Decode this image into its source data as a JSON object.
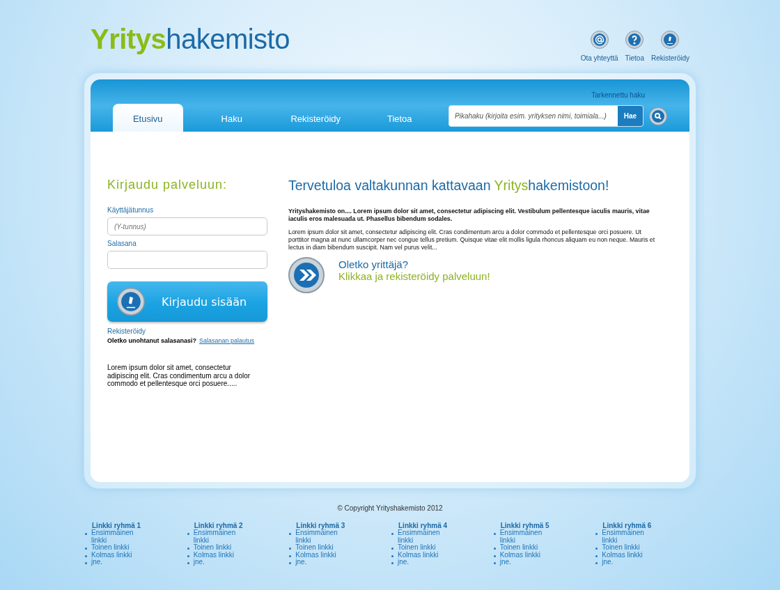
{
  "logo": {
    "first": "Yritys",
    "second": "hakemisto"
  },
  "top_links": [
    {
      "kind": "contact",
      "label": "Ota yhteyttä"
    },
    {
      "kind": "info",
      "label": "Tietoa"
    },
    {
      "kind": "register",
      "label": "Rekisteröidy"
    }
  ],
  "nav": {
    "tabs": [
      {
        "label": "Etusivu",
        "selected": true
      },
      {
        "label": "Haku",
        "selected": false
      },
      {
        "label": "Rekisteröidy",
        "selected": false
      },
      {
        "label": "Tietoa",
        "selected": false
      }
    ],
    "advanced_search": "Tarkennettu haku",
    "search": {
      "placeholder": "Pikahaku (kirjoita esim. yrityksen nimi, toimiala...)",
      "button": "Hae"
    }
  },
  "login": {
    "title": "Kirjaudu palveluun:",
    "fields": [
      {
        "label": "Käyttäjätunnus",
        "placeholder": "(Y-tunnus)"
      },
      {
        "label": "Salasana"
      }
    ],
    "button": "Kirjaudu sisään",
    "register": "Rekisteröidy",
    "forgot": "Oletko unohtanut salasanasi?",
    "reset": "Salasanan palautus",
    "text": "Lorem ipsum dolor sit amet, consectetur adipiscing elit. Cras condimentum arcu a dolor commodo et pellentesque orci posuere....."
  },
  "welcome": {
    "title": [
      {
        "text": "Tervetuloa valtakunnan kattavaan ",
        "highlight": false
      },
      {
        "text": "Yritys",
        "highlight": true
      },
      {
        "text": "hakemistoon!",
        "highlight": false
      }
    ],
    "intro": "Yrityshakemisto on.... Lorem ipsum dolor sit amet, consectetur adipiscing elit. Vestibulum pellentesque iaculis mauris, vitae iaculis eros malesuada ut. Phasellus bibendum sodales.",
    "body": "Lorem ipsum dolor sit amet, consectetur adipiscing elit. Cras condimentum arcu a dolor commodo et pellentesque orci posuere. Ut porttitor magna at nunc ullamcorper nec congue tellus pretium. Quisque vitae elit mollis ligula rhoncus aliquam eu non neque. Mauris et lectus in diam bibendum suscipit. Nam vel purus velit...",
    "cta_question": "Oletko yrittäjä?",
    "cta_action": "Klikkaa ja rekisteröidy palveluun!"
  },
  "copyright": "© Copyright Yrityshakemisto 2012",
  "footer_groups": [
    {
      "title": "Linkki ryhmä 1",
      "links": [
        "Ensimmäinen linkki",
        "Toinen linkki",
        "Kolmas linkki",
        "jne."
      ]
    },
    {
      "title": "Linkki ryhmä 2",
      "links": [
        "Ensimmäinen linkki",
        "Toinen linkki",
        "Kolmas linkki",
        "jne."
      ]
    },
    {
      "title": "Linkki ryhmä 3",
      "links": [
        "Ensimmäinen linkki",
        "Toinen linkki",
        "Kolmas linkki",
        "jne."
      ]
    },
    {
      "title": "Linkki ryhmä 4",
      "links": [
        "Ensimmäinen linkki",
        "Toinen linkki",
        "Kolmas linkki",
        "jne."
      ]
    },
    {
      "title": "Linkki ryhmä 5",
      "links": [
        "Ensimmäinen linkki",
        "Toinen linkki",
        "Kolmas linkki",
        "jne."
      ]
    },
    {
      "title": "Linkki ryhmä 6",
      "links": [
        "Ensimmäinen linkki",
        "Toinen linkki",
        "Kolmas linkki",
        "jne."
      ]
    }
  ]
}
